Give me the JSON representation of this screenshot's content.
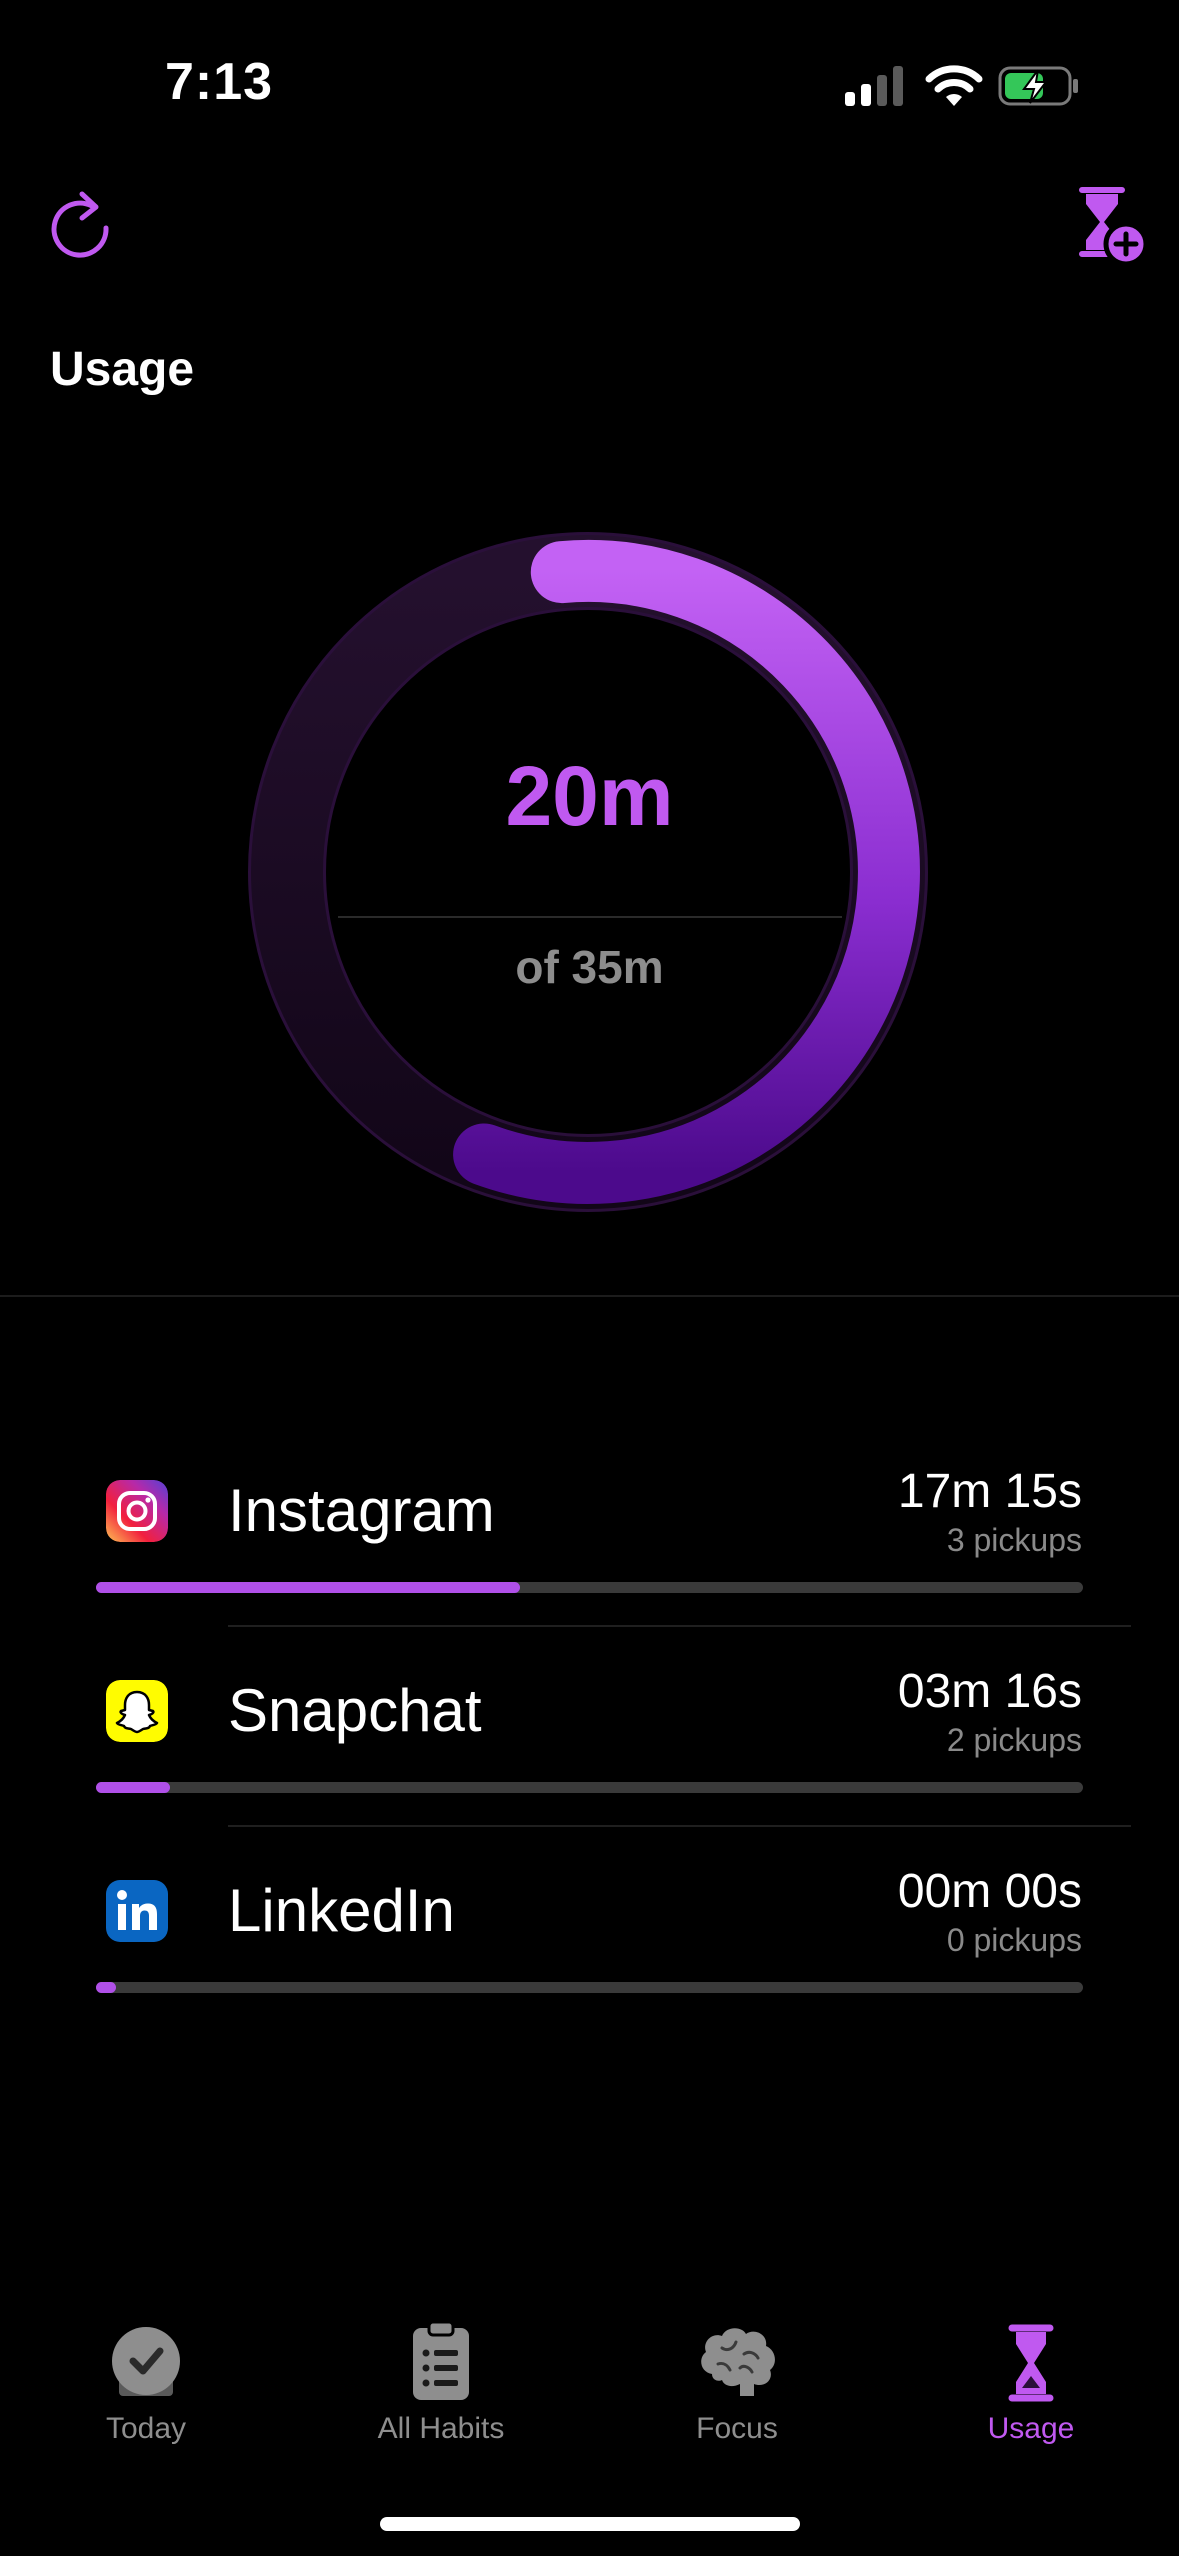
{
  "status_bar": {
    "time": "7:13"
  },
  "header": {
    "title": "Usage"
  },
  "ring": {
    "value_label": "20m",
    "limit_label": "of 35m",
    "progress_fraction": 0.57
  },
  "apps": [
    {
      "name": "Instagram",
      "time": "17m 15s",
      "pickups": "3 pickups",
      "progress_fraction": 0.43,
      "icon": "instagram-icon"
    },
    {
      "name": "Snapchat",
      "time": "03m 16s",
      "pickups": "2 pickups",
      "progress_fraction": 0.075,
      "icon": "snapchat-icon"
    },
    {
      "name": "LinkedIn",
      "time": "00m 00s",
      "pickups": "0 pickups",
      "progress_fraction": 0.02,
      "icon": "linkedin-icon"
    }
  ],
  "tabs": [
    {
      "label": "Today",
      "icon": "clock-check-icon",
      "active": false
    },
    {
      "label": "All Habits",
      "icon": "clipboard-list-icon",
      "active": false
    },
    {
      "label": "Focus",
      "icon": "brain-icon",
      "active": false
    },
    {
      "label": "Usage",
      "icon": "hourglass-icon",
      "active": true
    }
  ],
  "colors": {
    "accent": "#C059F0",
    "background": "#000000",
    "ring_dark": "#4A0A86",
    "track": "#3A3A3A"
  }
}
